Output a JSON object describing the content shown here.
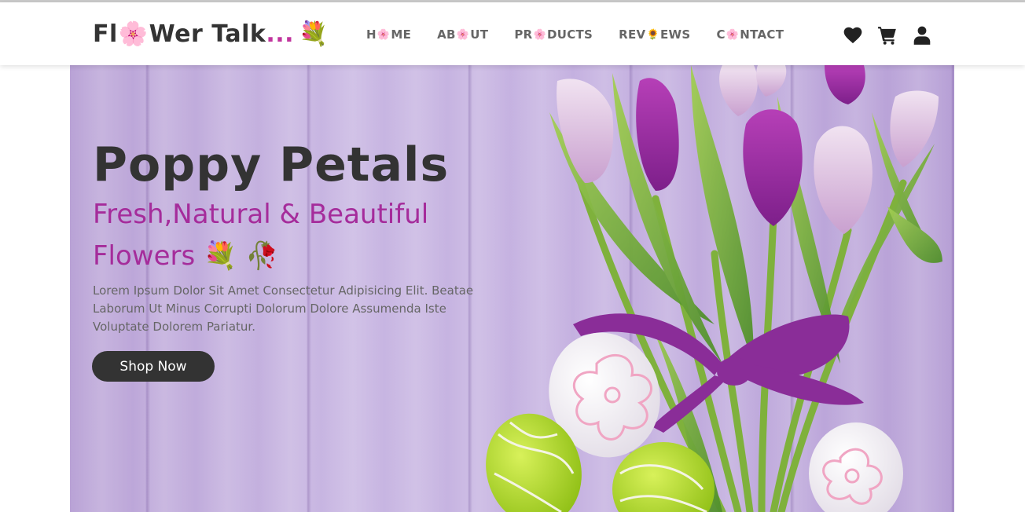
{
  "brand": {
    "part1": "Fl",
    "flower_glyph": "🌸",
    "part2": "Wer Talk",
    "dots": "...",
    "bouquet_glyph": "💐"
  },
  "nav": [
    {
      "pre": "H",
      "icon": "🌸",
      "post": "ME"
    },
    {
      "pre": "AB",
      "icon": "🌸",
      "post": "UT"
    },
    {
      "pre": "PR",
      "icon": "🌸",
      "post": "DUCTS"
    },
    {
      "pre": "REV",
      "icon": "🌻",
      "post": "EWS"
    },
    {
      "pre": "C",
      "icon": "🌸",
      "post": "NTACT"
    }
  ],
  "header_icons": [
    "heart-icon",
    "cart-icon",
    "user-icon"
  ],
  "hero": {
    "title": "Poppy Petals",
    "subtitle": "Fresh,Natural & Beautiful Flowers 💐 🥀",
    "description": "Lorem Ipsum Dolor Sit Amet Consectetur Adipisicing Elit. Beatae Laborum Ut Minus Corrupti Dolorum Dolore Assumenda Iste Voluptate Dolorem Pariatur.",
    "button_label": "Shop Now"
  },
  "colors": {
    "accent": "#a52c9b",
    "dark": "#333333",
    "hero_background": "#c4b0e0"
  }
}
